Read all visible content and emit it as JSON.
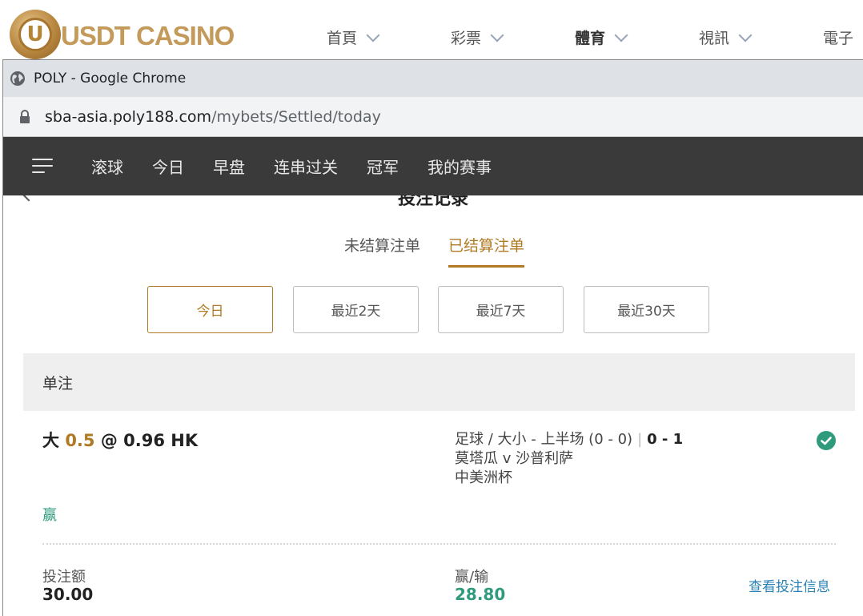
{
  "site": {
    "logo_text": "USDT CASINO",
    "logo_letter": "U",
    "nav": [
      {
        "label": "首頁"
      },
      {
        "label": "彩票"
      },
      {
        "label": "體育"
      },
      {
        "label": "視訊"
      },
      {
        "label": "電子"
      }
    ],
    "active_nav": "體育"
  },
  "chrome": {
    "window_title": "POLY - Google Chrome",
    "url_host": "sba-asia.poly188.com",
    "url_path": "/mybets/Settled/today"
  },
  "sportsbook": {
    "nav": [
      {
        "label": "滚球"
      },
      {
        "label": "今日"
      },
      {
        "label": "早盘"
      },
      {
        "label": "连串过关"
      },
      {
        "label": "冠军"
      },
      {
        "label": "我的赛事"
      }
    ]
  },
  "page": {
    "title": "投注记录",
    "tabs": [
      {
        "label": "未结算注单"
      },
      {
        "label": "已结算注单"
      }
    ],
    "active_tab": "已结算注单",
    "filters": [
      {
        "label": "今日"
      },
      {
        "label": "最近2天"
      },
      {
        "label": "最近7天"
      },
      {
        "label": "最近30天"
      }
    ],
    "active_filter": "今日",
    "section_title": "单注",
    "bet": {
      "selection": "大",
      "handicap": "0.5",
      "at": "@",
      "odds": "0.96 HK",
      "market": "足球 / 大小 - 上半场 (0 - 0)",
      "divider": "|",
      "score": "0 - 1",
      "match": "莫塔瓜 v 沙普利萨",
      "league": "中美洲杯",
      "result": "赢",
      "stake_label": "投注额",
      "stake": "30.00",
      "winloss_label": "赢/输",
      "winloss": "28.80",
      "view_details": "查看投注信息"
    }
  },
  "colors": {
    "accent_gold": "#b07a24",
    "win_green": "#2f9b7c",
    "link_blue": "#2a82b5",
    "nav_bg": "#3a3a3a"
  }
}
